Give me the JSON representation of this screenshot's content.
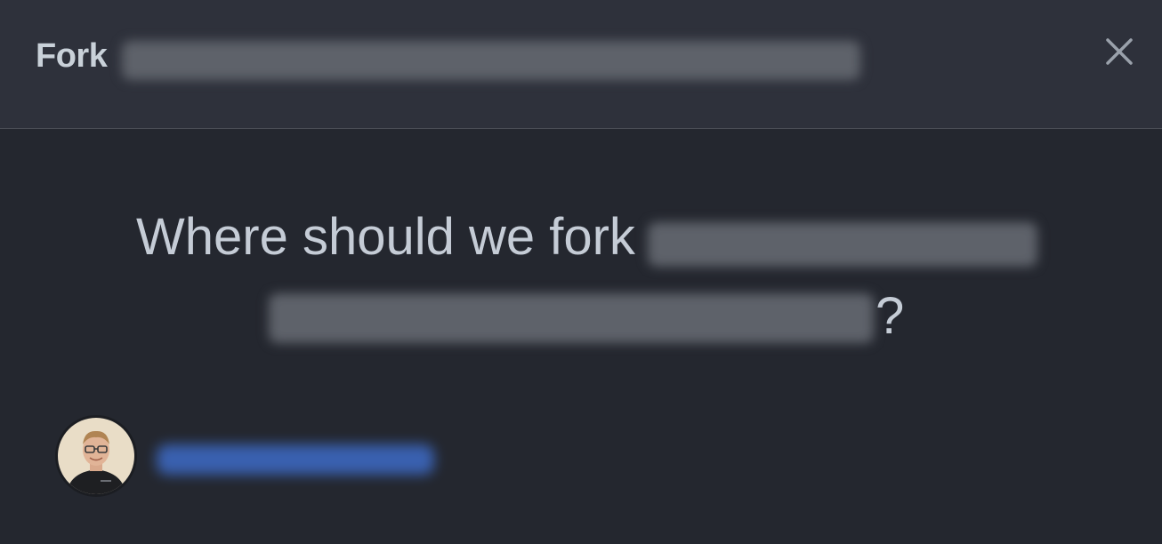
{
  "dialog": {
    "title_prefix": "Fork",
    "close_icon": "close-icon",
    "repo_name_visible": false
  },
  "prompt": {
    "question_start": "Where should we fork",
    "question_end": "?"
  },
  "owner": {
    "avatar_icon": "user-avatar",
    "username_visible": false
  },
  "colors": {
    "background": "#24272f",
    "header": "#2e313b",
    "text": "#c5ccd6",
    "link": "#3f6fd0"
  }
}
